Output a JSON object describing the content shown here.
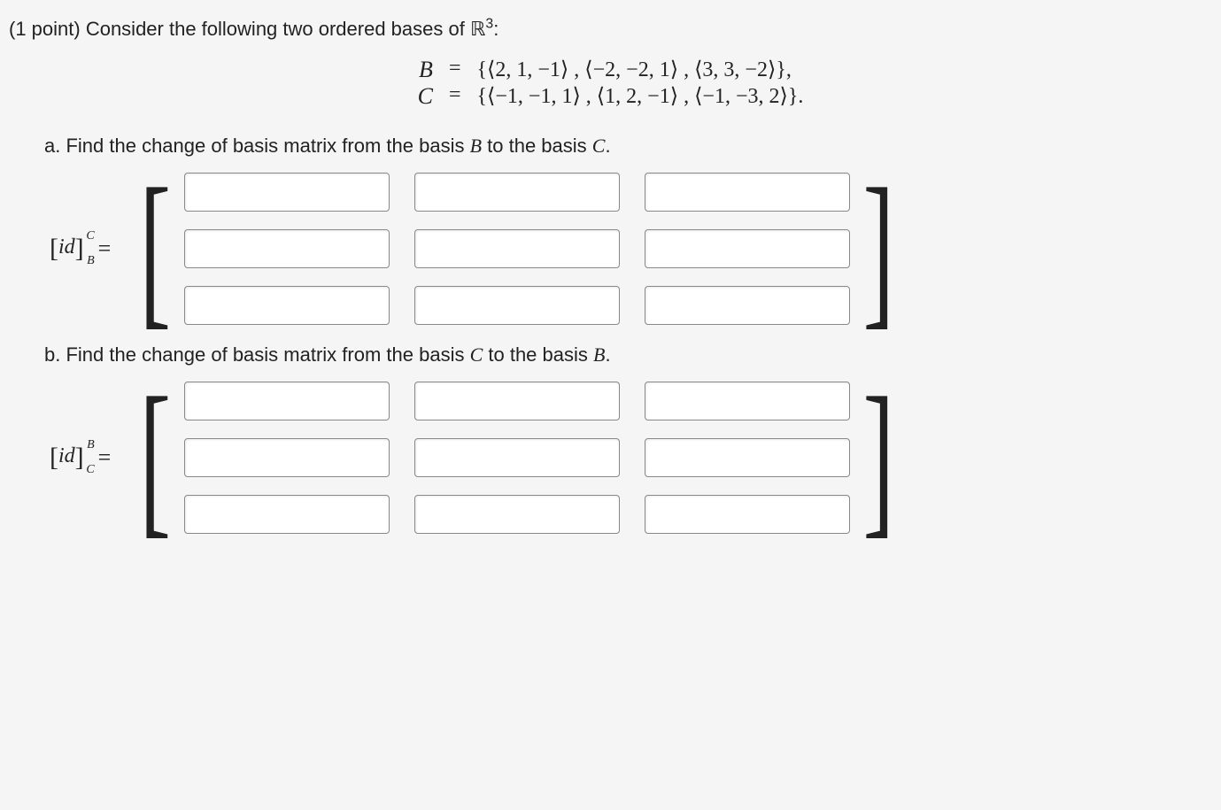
{
  "problem": {
    "points_prefix": "(1 point) ",
    "intro_text": "Consider the following two ordered bases of ",
    "space_symbol": "ℝ",
    "space_exponent": "3",
    "colon": ":"
  },
  "bases": {
    "B": {
      "symbol": "B",
      "eq": "=",
      "value": "{⟨2, 1, −1⟩ , ⟨−2, −2, 1⟩ , ⟨3, 3, −2⟩},"
    },
    "C": {
      "symbol": "C",
      "eq": "=",
      "value": "{⟨−1, −1, 1⟩ , ⟨1, 2, −1⟩ , ⟨−1, −3, 2⟩}."
    }
  },
  "parts": {
    "a": {
      "prefix": "a. ",
      "text_before": "Find the change of basis matrix from the basis ",
      "from_sym": "B",
      "text_mid": " to the basis ",
      "to_sym": "C",
      "text_after": ".",
      "label_id": "id",
      "label_sup": "C",
      "label_sub": "B",
      "eq": "="
    },
    "b": {
      "prefix": "b. ",
      "text_before": "Find the change of basis matrix from the basis ",
      "from_sym": "C",
      "text_mid": " to the basis ",
      "to_sym": "B",
      "text_after": ".",
      "label_id": "id",
      "label_sup": "B",
      "label_sub": "C",
      "eq": "="
    }
  },
  "brackets": {
    "left": "[",
    "right": "]"
  },
  "matrix_a": [
    [
      "",
      "",
      ""
    ],
    [
      "",
      "",
      ""
    ],
    [
      "",
      "",
      ""
    ]
  ],
  "matrix_b": [
    [
      "",
      "",
      ""
    ],
    [
      "",
      "",
      ""
    ],
    [
      "",
      "",
      ""
    ]
  ]
}
